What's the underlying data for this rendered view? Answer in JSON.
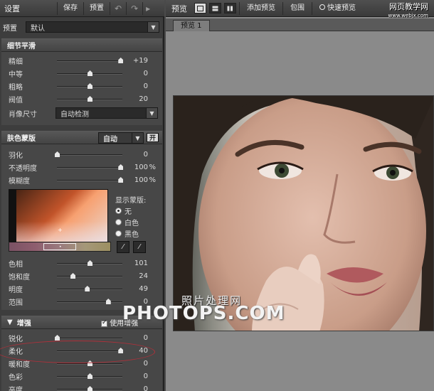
{
  "left_panel": {
    "title": "设置",
    "toolbar": {
      "save": "保存",
      "preset": "预置"
    },
    "preset_row": {
      "label": "预置",
      "value": "默认"
    },
    "detail": {
      "heading": "细节平滑",
      "rows": [
        {
          "label": "精细",
          "value": "+19",
          "level": 0.97
        },
        {
          "label": "中等",
          "value": "0",
          "level": 0.5
        },
        {
          "label": "粗略",
          "value": "0",
          "level": 0.5
        },
        {
          "label": "阀值",
          "value": "20",
          "level": 0.5
        }
      ],
      "size_label": "肖像尺寸",
      "size_value": "自动检测"
    },
    "skin": {
      "heading": "肤色蒙版",
      "mode": "自动",
      "open_button": "开",
      "rows": [
        {
          "label": "羽化",
          "value": "0",
          "unit": "",
          "level": 0.0
        },
        {
          "label": "不透明度",
          "value": "100",
          "unit": "%",
          "level": 0.97
        },
        {
          "label": "模糊度",
          "value": "100",
          "unit": "%",
          "level": 0.97
        }
      ],
      "show_mask_label": "显示蒙版:",
      "show_mask_options": [
        "无",
        "白色",
        "黑色"
      ],
      "show_mask_selected": 0,
      "hsl_rows": [
        {
          "label": "色相",
          "value": "101",
          "level": 0.5
        },
        {
          "label": "饱和度",
          "value": "24",
          "level": 0.24
        },
        {
          "label": "明度",
          "value": "49",
          "level": 0.46
        },
        {
          "label": "范围",
          "value": "0",
          "level": 0.78
        }
      ]
    },
    "enhance": {
      "heading": "增强",
      "use_label": "使用增强",
      "rows": [
        {
          "label": "锐化",
          "value": "0",
          "level": 0.0
        },
        {
          "label": "柔化",
          "value": "40",
          "level": 0.97
        },
        {
          "label": "暖和度",
          "value": "0",
          "level": 0.5
        },
        {
          "label": "色彩",
          "value": "0",
          "level": 0.5
        },
        {
          "label": "亮度",
          "value": "0",
          "level": 0.5
        }
      ]
    }
  },
  "right_panel": {
    "title": "预览",
    "add_preview": "添加预览",
    "bracket": "包围",
    "quick_preview": "快速预览",
    "tab": "预览 1"
  },
  "watermarks": {
    "site_cn": "照片处理网",
    "site_en": "PHOTOPS.COM",
    "corner_line1": "网页教学网",
    "corner_line2": "www.webjx.com"
  },
  "colors": {
    "panel": "#3d3d3d",
    "section": "#474747",
    "highlight": "#b0303a"
  }
}
